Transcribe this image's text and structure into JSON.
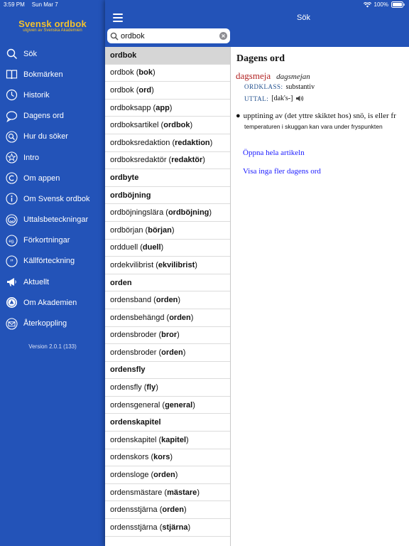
{
  "status": {
    "time": "3:59 PM",
    "date": "Sun Mar 7",
    "battery": "100%"
  },
  "logo": {
    "title": "Svensk ordbok",
    "subtitle": "utgiven av Svenska Akademien"
  },
  "menu": [
    {
      "label": "Sök",
      "icon": "search-icon"
    },
    {
      "label": "Bokmärken",
      "icon": "book-icon"
    },
    {
      "label": "Historik",
      "icon": "clock-icon"
    },
    {
      "label": "Dagens ord",
      "icon": "speech-bubble-icon"
    },
    {
      "label": "Hur du söker",
      "icon": "search-circle-icon"
    },
    {
      "label": "Intro",
      "icon": "star-icon"
    },
    {
      "label": "Om appen",
      "icon": "copyright-icon"
    },
    {
      "label": "Om Svensk ordbok",
      "icon": "info-icon"
    },
    {
      "label": "Uttalsbeteckningar",
      "icon": "smile-icon"
    },
    {
      "label": "Förkortningar",
      "icon": "abbreviation-icon"
    },
    {
      "label": "Källförteckning",
      "icon": "quote-icon"
    },
    {
      "label": "Aktuellt",
      "icon": "megaphone-icon"
    },
    {
      "label": "Om Akademien",
      "icon": "academy-seal-icon"
    },
    {
      "label": "Återkoppling",
      "icon": "mail-icon"
    }
  ],
  "version": "Version 2.0.1 (133)",
  "nav": {
    "title": "Sök"
  },
  "search": {
    "value": "ordbok",
    "placeholder": "Sök"
  },
  "results": [
    {
      "word": "ordbok",
      "base": "",
      "header": true,
      "selected": true
    },
    {
      "word": "ordbok",
      "base": "bok"
    },
    {
      "word": "ordbok",
      "base": "ord"
    },
    {
      "word": "ordboksapp",
      "base": "app"
    },
    {
      "word": "ordboksartikel",
      "base": "ordbok"
    },
    {
      "word": "ordboksredaktion",
      "base": "redaktion"
    },
    {
      "word": "ordboksredaktör",
      "base": "redaktör"
    },
    {
      "word": "ordbyte",
      "base": "",
      "header": true
    },
    {
      "word": "ordböjning",
      "base": "",
      "header": true
    },
    {
      "word": "ordböjningslära",
      "base": "ordböjning"
    },
    {
      "word": "ordbörjan",
      "base": "början"
    },
    {
      "word": "ordduell",
      "base": "duell"
    },
    {
      "word": "ordekvilibrist",
      "base": "ekvilibrist"
    },
    {
      "word": "orden",
      "base": "",
      "header": true
    },
    {
      "word": "ordensband",
      "base": "orden"
    },
    {
      "word": "ordensbehängd",
      "base": "orden"
    },
    {
      "word": "ordensbroder",
      "base": "bror"
    },
    {
      "word": "ordensbroder",
      "base": "orden"
    },
    {
      "word": "ordensfly",
      "base": "",
      "header": true
    },
    {
      "word": "ordensfly",
      "base": "fly"
    },
    {
      "word": "ordensgeneral",
      "base": "general"
    },
    {
      "word": "ordenskapitel",
      "base": "",
      "header": true
    },
    {
      "word": "ordenskapitel",
      "base": "kapitel"
    },
    {
      "word": "ordenskors",
      "base": "kors"
    },
    {
      "word": "ordensloge",
      "base": "orden"
    },
    {
      "word": "ordensmästare",
      "base": "mästare"
    },
    {
      "word": "ordensstjärna",
      "base": "orden"
    },
    {
      "word": "ordensstjärna",
      "base": "stjärna"
    }
  ],
  "detail": {
    "heading": "Dagens ord",
    "headword": "dagsmeja",
    "inflection": "dagsmejan",
    "ordklass_label": "ORDKLASS:",
    "ordklass_value": "substantiv",
    "uttal_label": "UTTAL:",
    "uttal_value": "[dak's-]",
    "definition": "upptining av (det yttre skiktet hos) snö, is eller fr",
    "example": "temperaturen i skuggan kan vara under fryspunkten",
    "link_open": "Öppna hela artikeln",
    "link_hide": "Visa inga fler dagens ord"
  }
}
